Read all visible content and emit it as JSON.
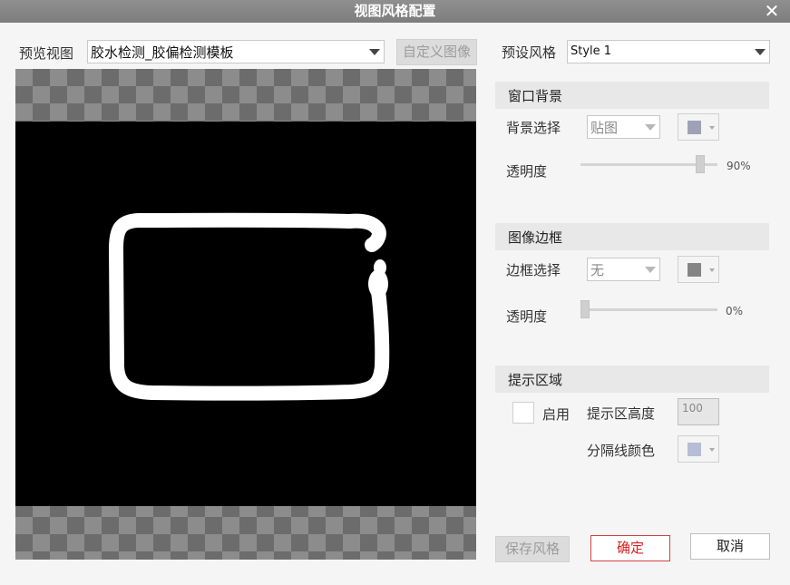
{
  "window": {
    "title": "视图风格配置",
    "close_glyph": "✕"
  },
  "preview": {
    "label": "预览视图",
    "selected_view": "胶水检测_胶偏检测模板",
    "custom_image_button": "自定义图像"
  },
  "preset": {
    "label": "预设风格",
    "selected": "Style 1"
  },
  "window_background": {
    "header": "窗口背景",
    "bg_select_label": "背景选择",
    "bg_select_value": "贴图",
    "bg_color": "#9fa2b6",
    "opacity_label": "透明度",
    "opacity_value": "90%",
    "opacity_fraction": 0.9
  },
  "image_border": {
    "header": "图像边框",
    "border_select_label": "边框选择",
    "border_select_value": "无",
    "border_color": "#858585",
    "opacity_label": "透明度",
    "opacity_value": "0%",
    "opacity_fraction": 0.0
  },
  "tip_area": {
    "header": "提示区域",
    "enable_label": "启用",
    "enabled": false,
    "height_label": "提示区高度",
    "height_value": "100",
    "separator_label": "分隔线颜色",
    "separator_color": "#b7bdd6"
  },
  "footer": {
    "save_style": "保存风格",
    "ok": "确定",
    "cancel": "取消"
  },
  "icons": {
    "close": "close-icon",
    "dropdown": "chevron-down-icon"
  }
}
